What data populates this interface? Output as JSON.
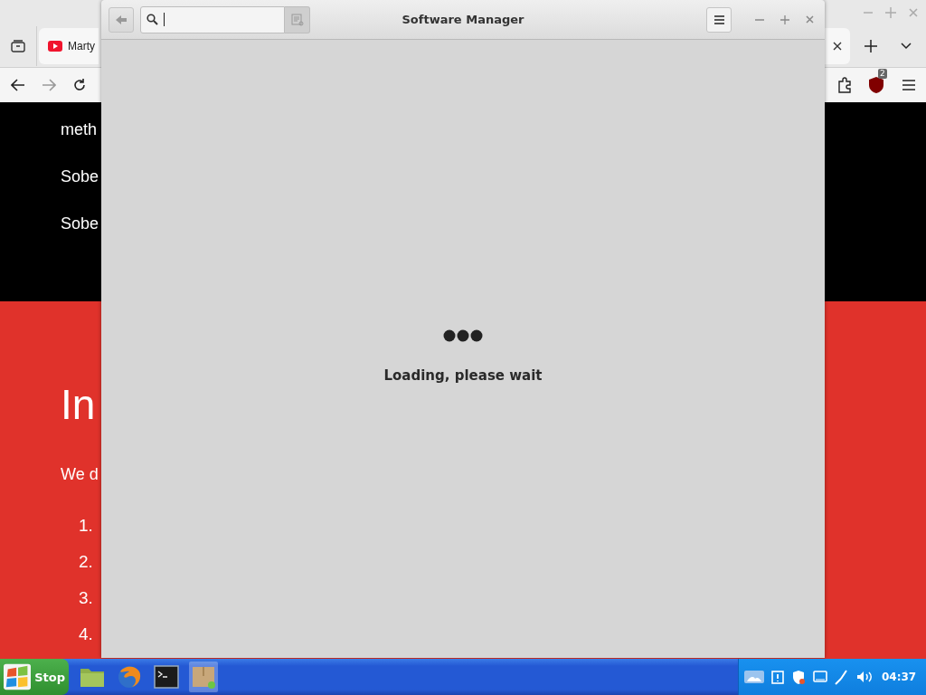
{
  "browser": {
    "tabs": [
      {
        "title": "Marty",
        "selected": true
      }
    ],
    "extension_badge": "2",
    "page": {
      "dark_section": {
        "lines": [
          "meth",
          "Sobe",
          "Sobe"
        ]
      },
      "red_section": {
        "heading": "In",
        "paragraph": "We d",
        "list": [
          {
            "number": "1."
          },
          {
            "number": "2."
          },
          {
            "number": "3."
          },
          {
            "number": "4."
          }
        ]
      }
    }
  },
  "software_manager": {
    "window": {
      "title": "Software Manager"
    },
    "search": {
      "focused": true
    },
    "status": "Loading, please wait"
  },
  "taskbar": {
    "start_button": "Stop",
    "apps": [
      {
        "kind": "folder",
        "selected": false
      },
      {
        "kind": "browser",
        "selected": false
      },
      {
        "kind": "terminal",
        "selected": false
      },
      {
        "kind": "package",
        "selected": true
      }
    ],
    "clock": "04:37"
  }
}
